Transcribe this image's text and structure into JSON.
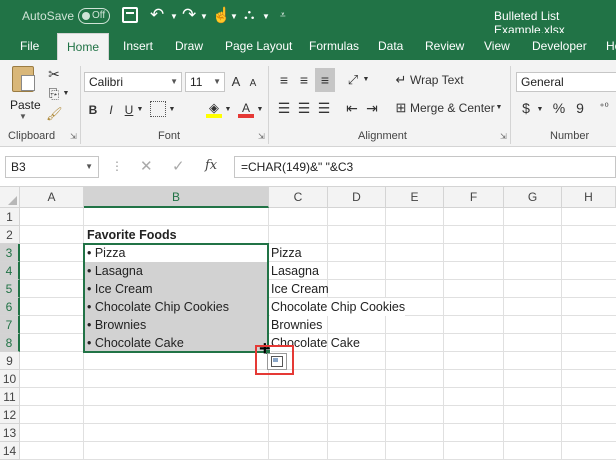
{
  "titlebar": {
    "autosave_label": "AutoSave",
    "autosave_state": "Off",
    "filename": "Bulleted List Example.xlsx"
  },
  "ribbon_tabs": [
    "File",
    "Home",
    "Insert",
    "Draw",
    "Page Layout",
    "Formulas",
    "Data",
    "Review",
    "View",
    "Developer",
    "He"
  ],
  "active_tab": "Home",
  "clipboard": {
    "paste_label": "Paste",
    "group_label": "Clipboard"
  },
  "font": {
    "name": "Calibri",
    "size": "11",
    "group_label": "Font",
    "grow": "A",
    "shrink": "A",
    "bold": "B",
    "italic": "I",
    "underline": "U",
    "font_color": "A"
  },
  "alignment": {
    "wrap_text": "Wrap Text",
    "merge_center": "Merge & Center",
    "group_label": "Alignment"
  },
  "number": {
    "format": "General",
    "currency": "$",
    "percent": "%",
    "comma": "9",
    "group_label": "Number"
  },
  "formula_bar": {
    "name_box": "B3",
    "fx": "fx",
    "formula": "=CHAR(149)&\" \"&C3"
  },
  "grid": {
    "columns": [
      "A",
      "B",
      "C",
      "D",
      "E",
      "F",
      "G",
      "H"
    ],
    "rows": [
      "1",
      "2",
      "3",
      "4",
      "5",
      "6",
      "7",
      "8",
      "9",
      "10",
      "11",
      "12",
      "13",
      "14"
    ],
    "header_cell": "Favorite Foods",
    "col_b": [
      "• Pizza",
      "• Lasagna",
      "• Ice Cream",
      "• Chocolate Chip Cookies",
      "• Brownies",
      "• Chocolate Cake"
    ],
    "col_c": [
      "Pizza",
      "Lasagna",
      "Ice Cream",
      "Chocolate Chip Cookies",
      "Brownies",
      "Chocolate Cake"
    ]
  },
  "colors": {
    "accent": "#217346",
    "selection": "#d2d2d2",
    "highlight_box": "#e53935"
  }
}
